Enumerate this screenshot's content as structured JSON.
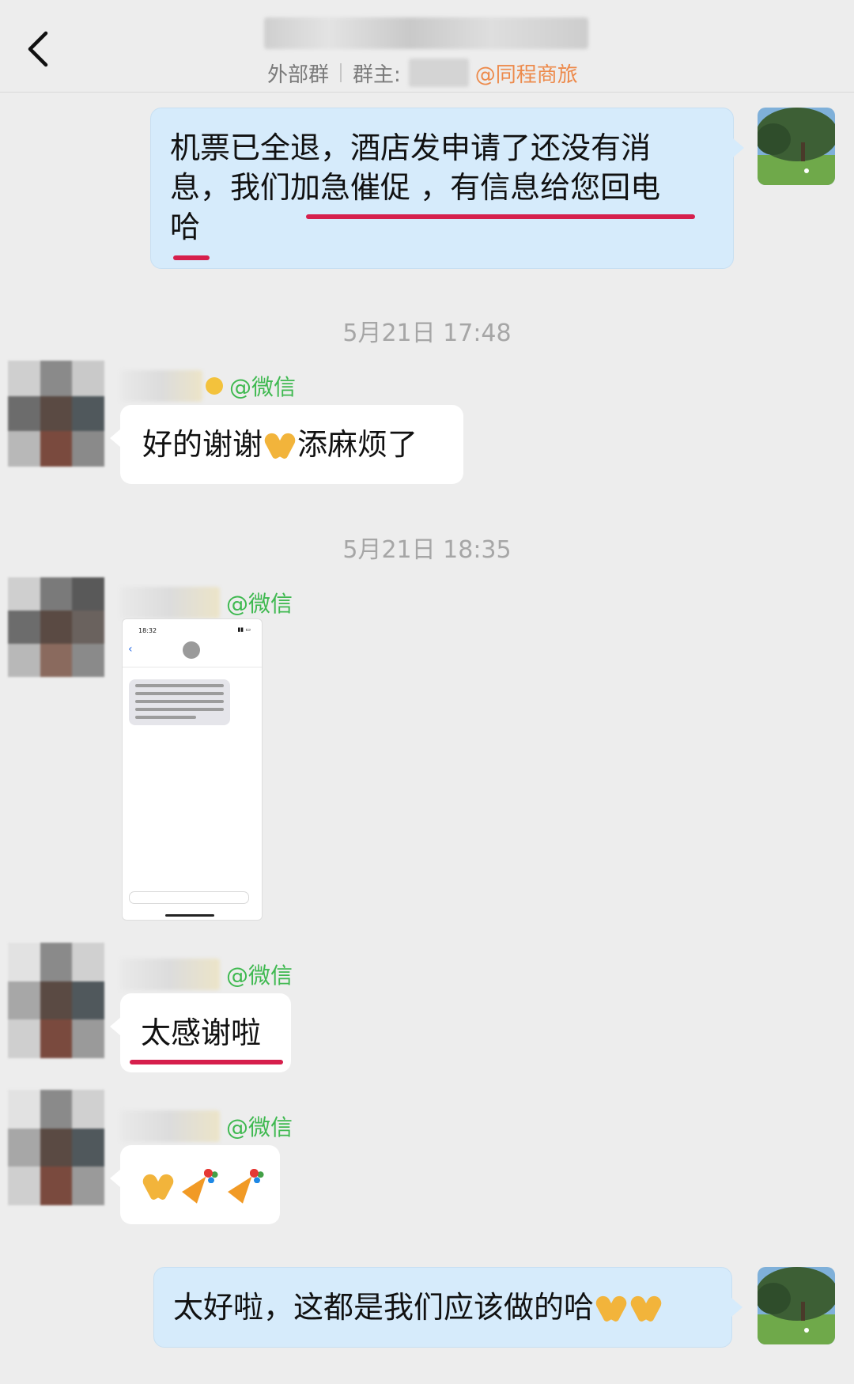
{
  "header": {
    "group_type": "外部群",
    "owner_label": "群主:",
    "owner_company": "@同程商旅"
  },
  "messages": {
    "msg1": {
      "line1": "机票已全退，酒店发申请了还没有消",
      "line2": "息，我们加急催促 ，有信息给您回电",
      "line3": "哈"
    },
    "time1": "5月21日 17:48",
    "msg2": {
      "tag": "@微信",
      "text": "好的谢谢",
      "text_after": "添麻烦了"
    },
    "time2": "5月21日 18:35",
    "msg3": {
      "tag": "@微信",
      "phone_time": "18:32"
    },
    "msg4": {
      "tag": "@微信",
      "text": "太感谢啦"
    },
    "msg5": {
      "tag": "@微信"
    },
    "msg6": {
      "text": "太好啦，这都是我们应该做的哈"
    }
  },
  "colors": {
    "background": "#ededed",
    "my_bubble": "#d6ebfb",
    "other_bubble": "#ffffff",
    "underline": "#d61f4c",
    "wechat_tag": "#3fb950",
    "company_tag": "#ed8a4b"
  },
  "icons": [
    "back-arrow-icon",
    "folded-hands-icon",
    "party-popper-icon"
  ]
}
